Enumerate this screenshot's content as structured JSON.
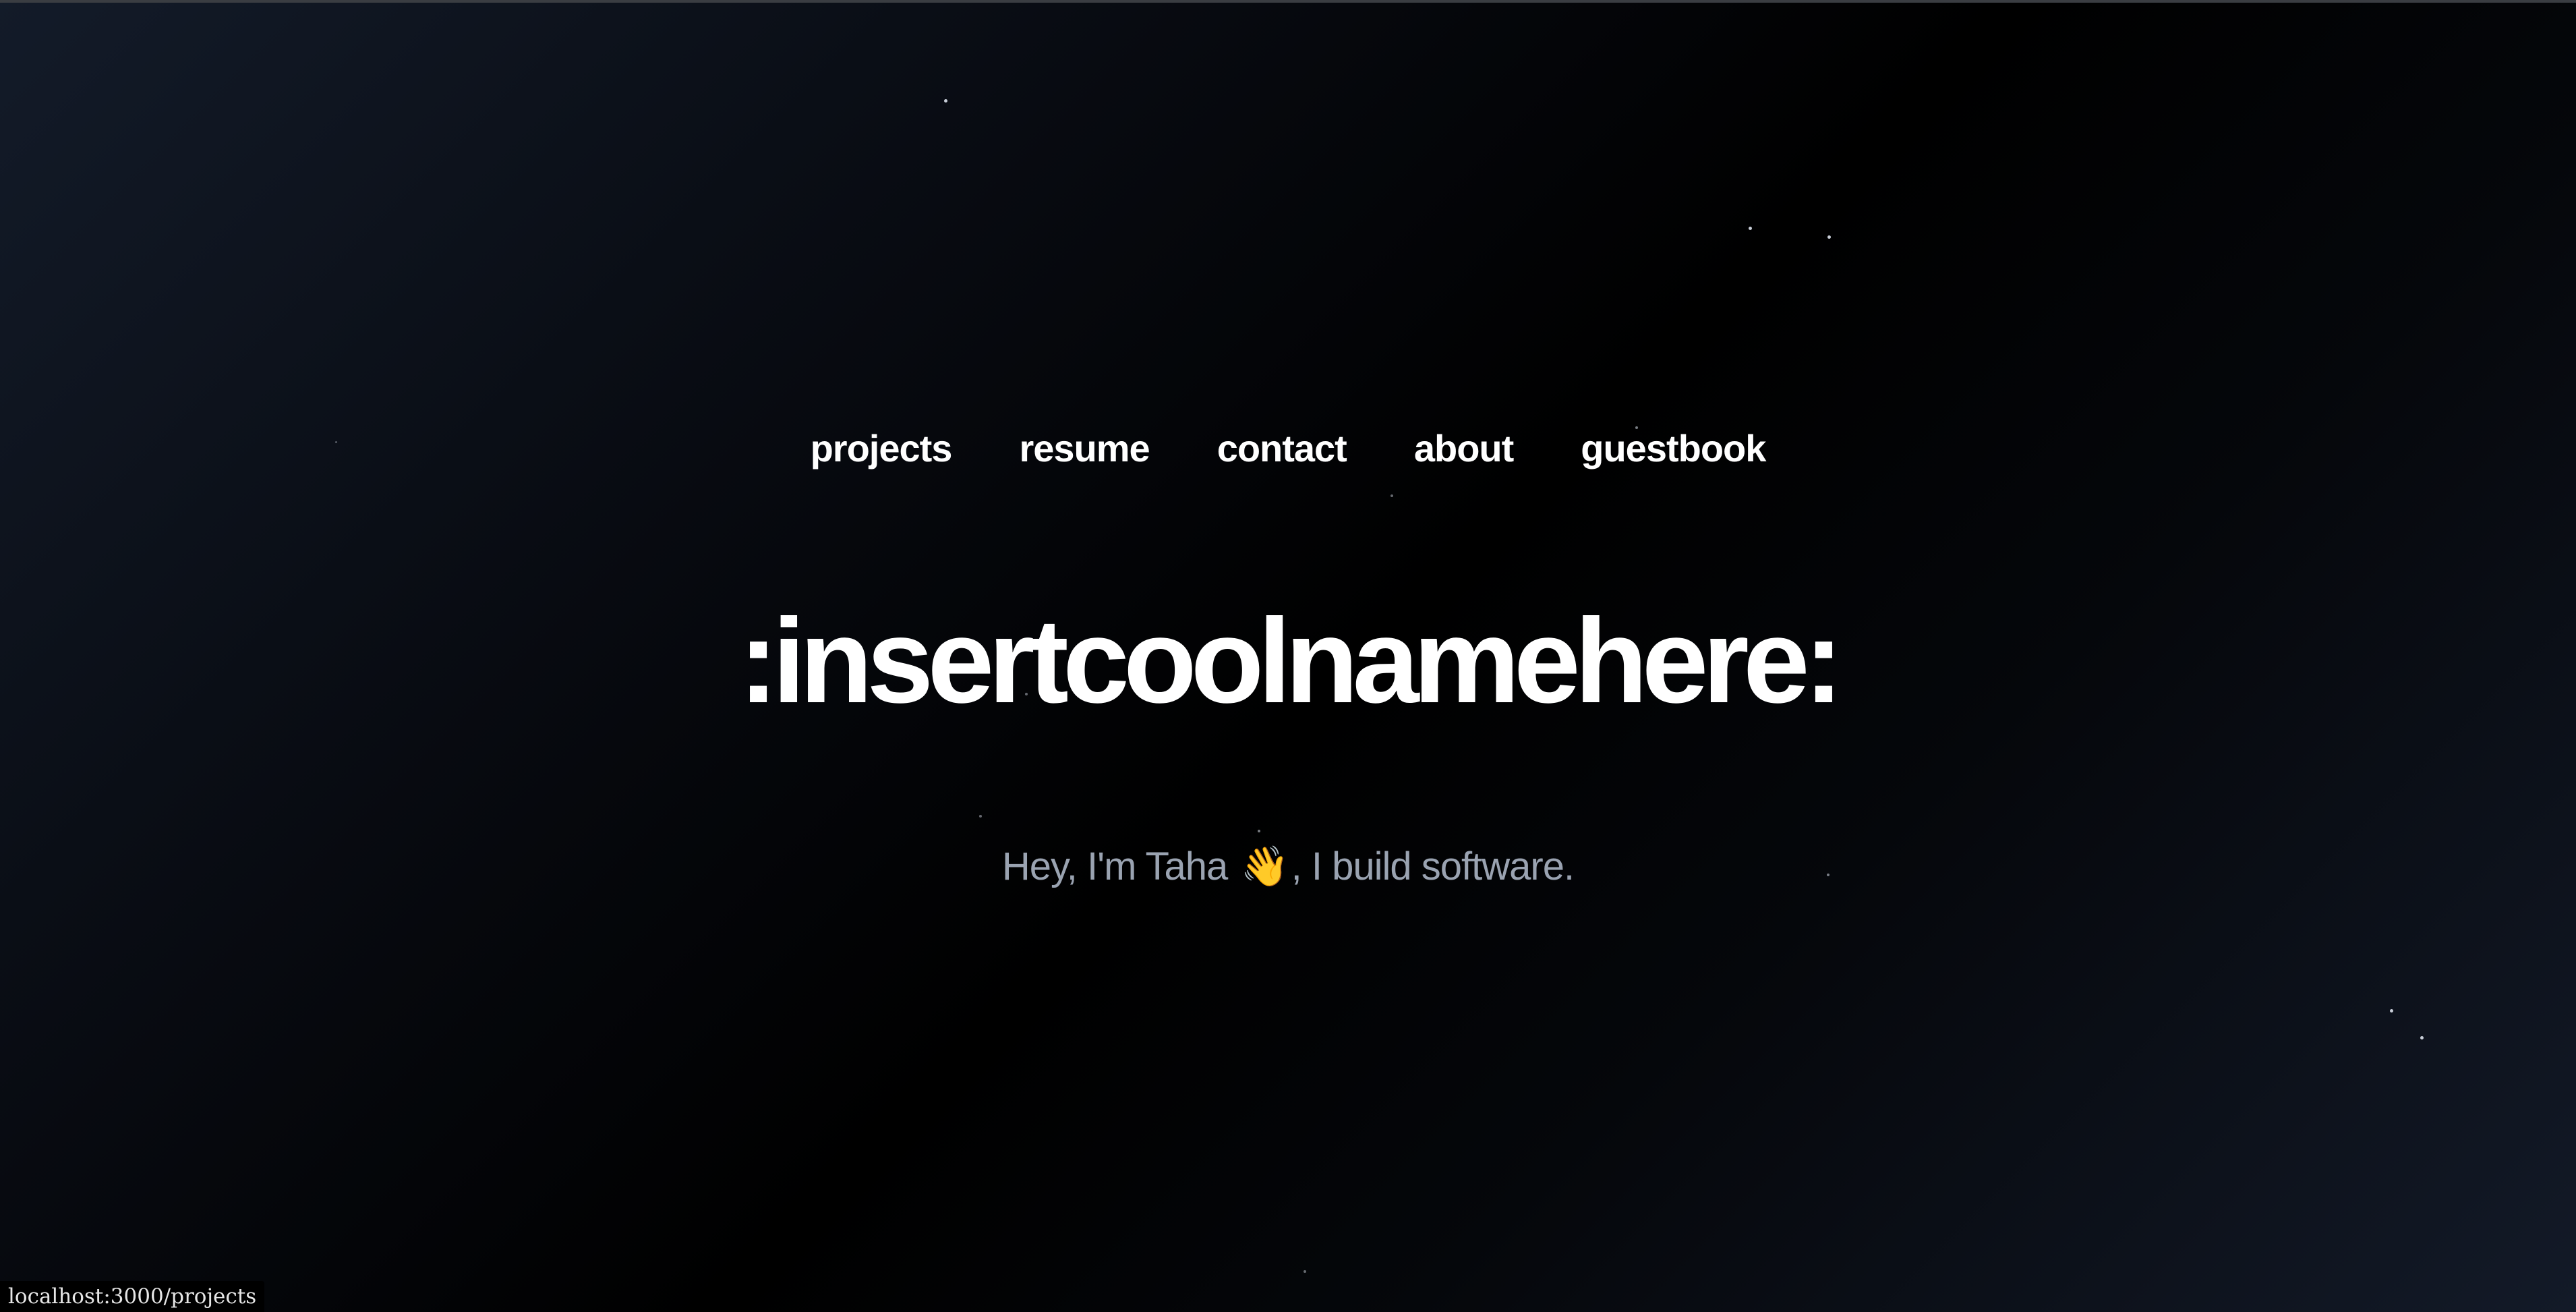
{
  "nav": {
    "items": [
      {
        "label": "projects"
      },
      {
        "label": "resume"
      },
      {
        "label": "contact"
      },
      {
        "label": "about"
      },
      {
        "label": "guestbook"
      }
    ]
  },
  "hero": {
    "title": ":insertcoolnamehere:",
    "tagline_before": "Hey, I'm Taha ",
    "tagline_emoji": "👋",
    "tagline_after": ", I build software."
  },
  "status_bar": {
    "url": "localhost:3000/projects"
  },
  "colors": {
    "title": "#ffffff",
    "nav": "#ffffff",
    "tagline": "#9aa3b1",
    "background_dark": "#000000",
    "background_light": "#131b29"
  },
  "icons": [
    "waving-hand-emoji"
  ]
}
